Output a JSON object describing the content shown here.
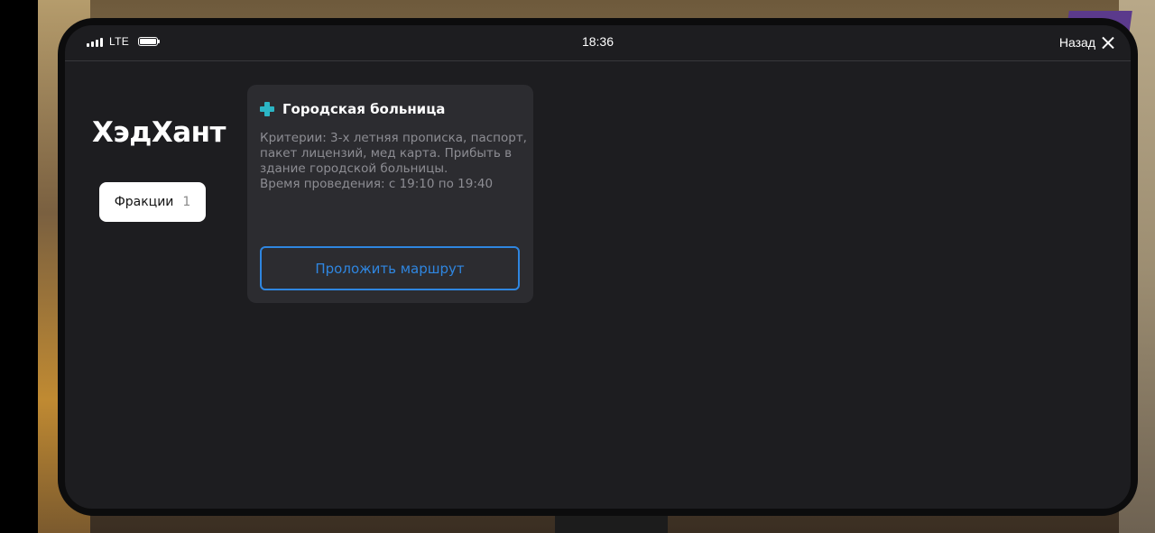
{
  "status_bar": {
    "network": "LTE",
    "time": "18:36",
    "back_label": "Назад"
  },
  "app": {
    "title": "ХэдХант"
  },
  "tabs": [
    {
      "label": "Фракции",
      "count": "1",
      "active": true
    }
  ],
  "cards": [
    {
      "icon": "medical-cross-icon",
      "title": "Городская больница",
      "description_lines": [
        "Критерии: 3-х летняя прописка, паспорт,",
        "пакет лицензий, мед карта. Прибыть в",
        "здание городской больницы.",
        "Время проведения: с 19:10 по 19:40"
      ],
      "action_label": "Проложить маршрут"
    }
  ],
  "colors": {
    "screen_bg": "#1d1d20",
    "card_bg": "#2c2c30",
    "accent_blue": "#2f86e0",
    "cross_teal": "#2bb5c4"
  }
}
